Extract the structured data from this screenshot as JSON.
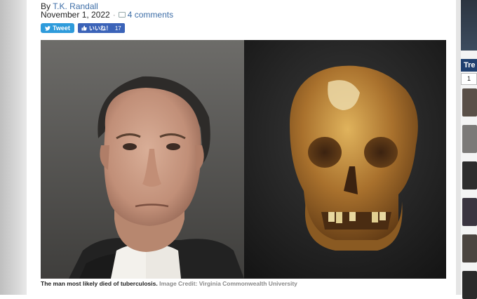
{
  "article": {
    "byline_prefix": "By",
    "author": "T.K. Randall",
    "date": "November 1, 2022",
    "separator": "·",
    "comments": "4 comments"
  },
  "share": {
    "tweet_label": "Tweet",
    "like_label": "いいね！",
    "like_count": "17"
  },
  "image": {
    "caption": "The man most likely died of tuberculosis.",
    "credit": "Image Credit: Virginia Commonwealth University"
  },
  "sidebar": {
    "header": "Tre",
    "tab": "1"
  },
  "colors": {
    "link": "#3f6fa8",
    "tweet_bg": "#2e9bdb",
    "like_bg": "#3b63b8",
    "sidebar_header": "#1f3f6f"
  }
}
